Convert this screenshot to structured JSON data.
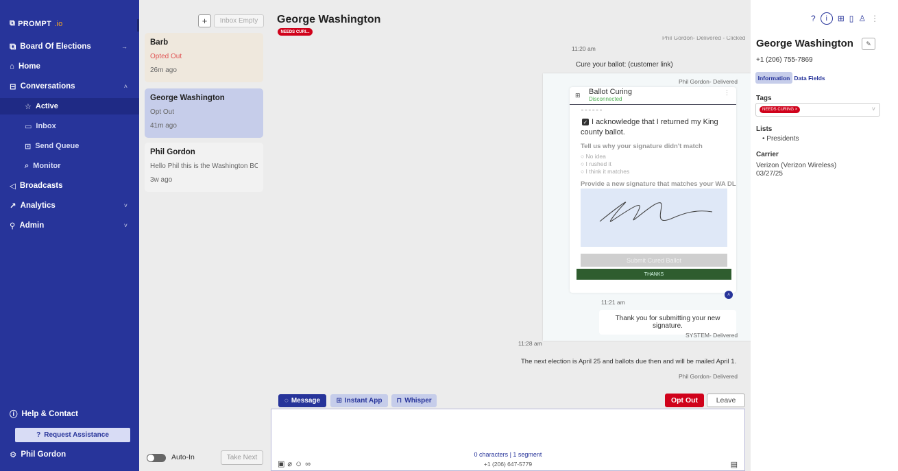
{
  "sidebar": {
    "logo": {
      "prefix": "PROMPT",
      "suffix": ".io"
    },
    "items": [
      {
        "label": "Board Of Elections",
        "icon": "board-icon"
      },
      {
        "label": "Home",
        "icon": "home-icon"
      },
      {
        "label": "Conversations",
        "icon": "chat-icon"
      },
      {
        "label": "Active",
        "icon": "star-icon"
      },
      {
        "label": "Inbox",
        "icon": "inbox-icon"
      },
      {
        "label": "Send Queue",
        "icon": "queue-icon"
      },
      {
        "label": "Monitor",
        "icon": "monitor-icon"
      },
      {
        "label": "Broadcasts",
        "icon": "broadcast-icon"
      },
      {
        "label": "Analytics",
        "icon": "analytics-icon"
      },
      {
        "label": "Admin",
        "icon": "admin-icon"
      }
    ],
    "help_label": "Help & Contact",
    "request_assistance_label": "Request Assistance",
    "user_name": "Phil Gordon"
  },
  "convlist": {
    "inbox_empty_label": "Inbox Empty",
    "conversations": [
      {
        "name": "Barb",
        "status": "Opted Out",
        "time": "26m ago"
      },
      {
        "name": "George Washington",
        "status": "Opt Out",
        "time": "41m ago"
      },
      {
        "name": "Phil Gordon",
        "status": "Hello Phil this is the Washington BO...",
        "time": "3w ago"
      }
    ],
    "auto_in_label": "Auto-In",
    "take_next_label": "Take Next"
  },
  "main": {
    "title": "George Washington",
    "badge": "NEEDS CURI...",
    "messages": {
      "m1_time": "11:20 am",
      "m1_text": "Cure your ballot: (customer link)",
      "m1_top_meta": "Phil Gordon- Delivered - Clicked",
      "app_meta": "Phil Gordon- Delivered",
      "m2_time": "11:21 am",
      "m2_text": "Thank you for submitting your new signature.",
      "m2_meta": "SYSTEM- Delivered",
      "m3_time": "11:28 am",
      "m3_text": "The next election is April 25 and ballots due then and will be mailed April 1.",
      "m3_meta": "Phil Gordon- Delivered"
    },
    "app": {
      "title": "Ballot Curing",
      "subtitle": "Disconnected",
      "ack": "I acknowledge that I returned my King county ballot.",
      "question": "Tell us why your signature didn't match",
      "options": [
        "No idea",
        "I rushed it",
        "I think it matches"
      ],
      "signature_prompt": "Provide a new signature that matches your WA DL",
      "submit_label": "Submit Cured Ballot",
      "thanks_label": "THANKS"
    },
    "compose": {
      "tabs": [
        "Message",
        "Instant App",
        "Whisper"
      ],
      "opt_out_label": "Opt Out",
      "leave_label": "Leave",
      "char_count": "0 characters | 1 segment",
      "sender_number": "+1 (206) 647-5779"
    }
  },
  "rightpanel": {
    "name": "George Washington",
    "phone": "+1 (206) 755-7869",
    "tabs": [
      "Information",
      "Data Fields"
    ],
    "tags_label": "Tags",
    "tag_chip": "NEEDS CURING",
    "lists_label": "Lists",
    "list_item": "Presidents",
    "carrier_label": "Carrier",
    "carrier_value": "Verizon (Verizon Wireless)",
    "carrier_date": "03/27/25"
  },
  "colors": {
    "brand": "#27349a",
    "danger": "#d0021b",
    "thanks_green": "#2f5d2f"
  }
}
